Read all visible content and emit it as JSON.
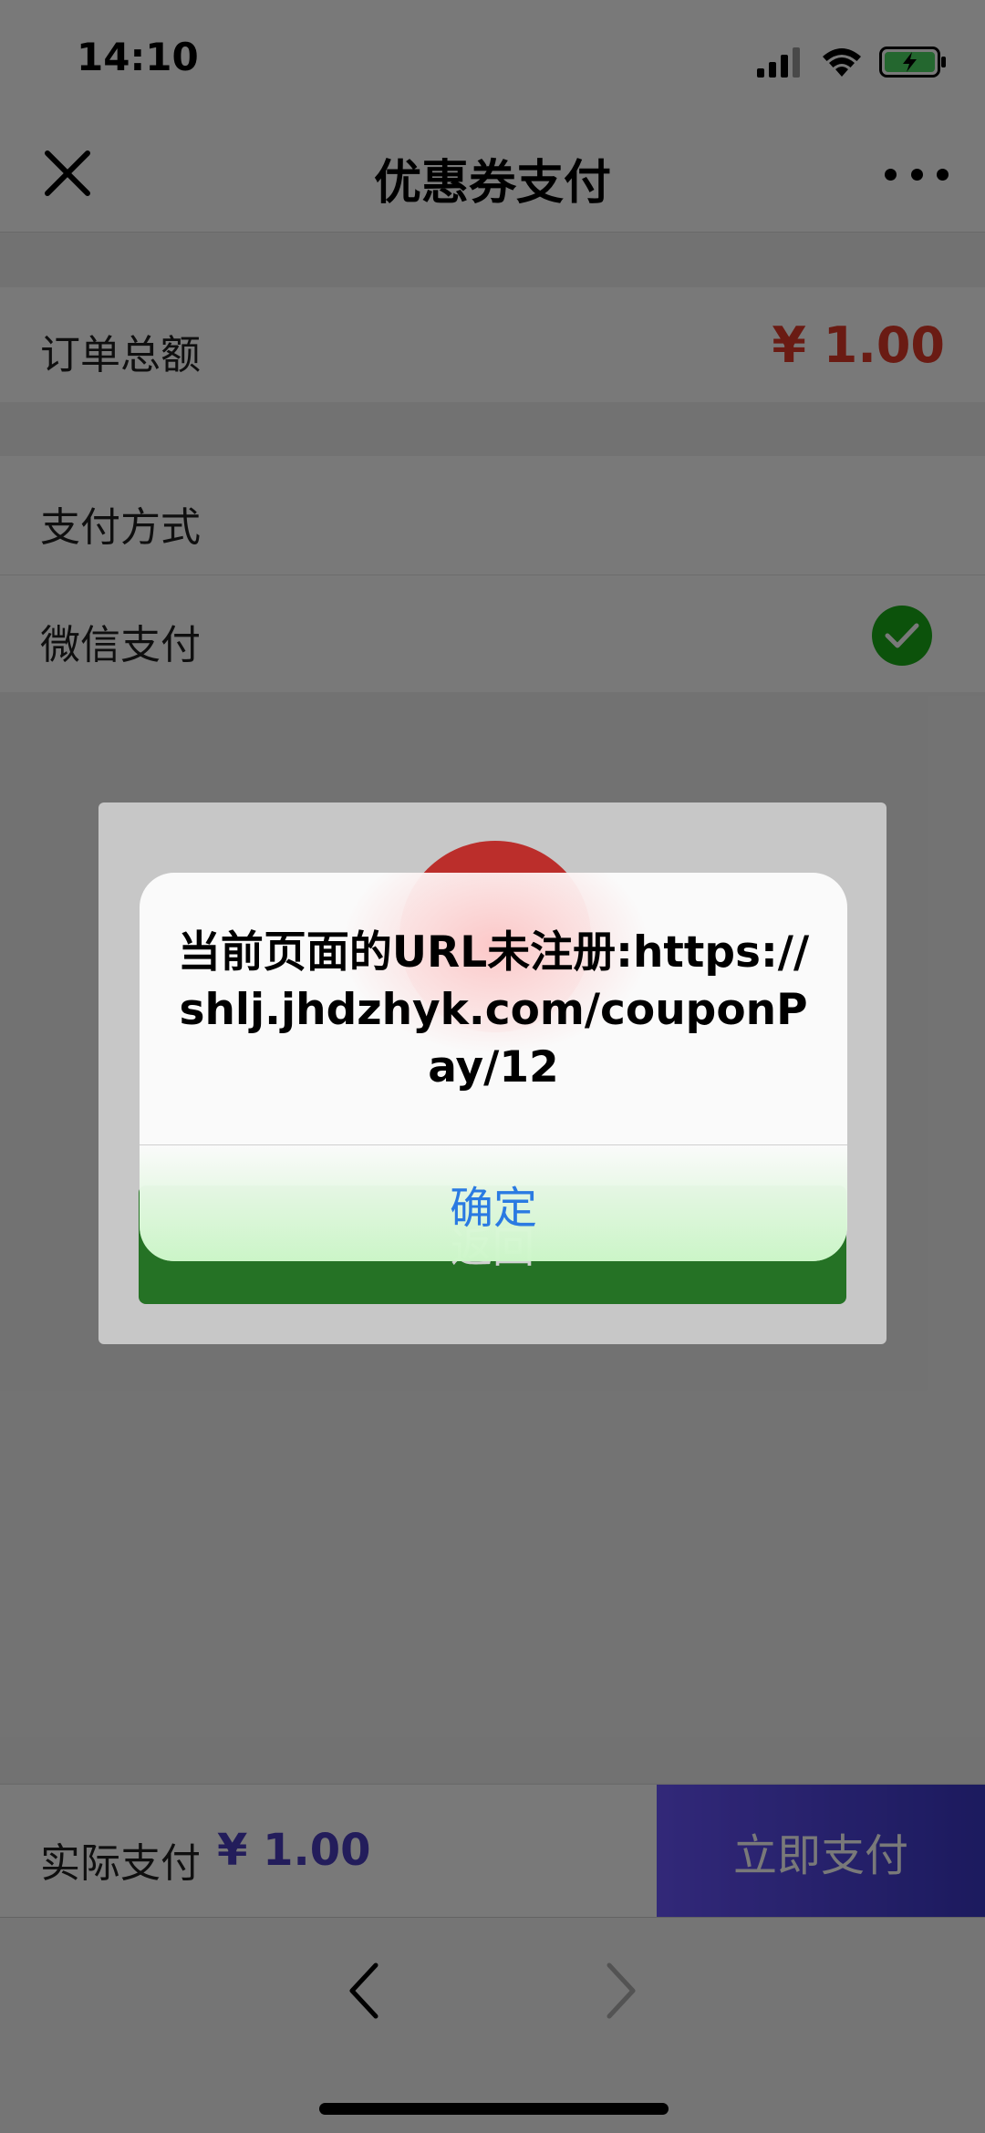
{
  "status_bar": {
    "time": "14:10"
  },
  "nav": {
    "title": "优惠券支付"
  },
  "order": {
    "label": "订单总额",
    "amount": "¥ 1.00"
  },
  "payment": {
    "header": "支付方式",
    "method": "微信支付"
  },
  "bottom": {
    "actual_label": "实际支付",
    "actual_amount": "¥ 1.00",
    "pay_button": "立即支付"
  },
  "page_modal": {
    "button_label": "返回"
  },
  "alert": {
    "message": "当前页面的URL未注册:https://shlj.jhdzhyk.com/couponPay/12",
    "ok_label": "确定"
  },
  "colors": {
    "price_red": "#e03c2a",
    "pay_button_start": "#6a56ff",
    "pay_button_end": "#3c39c7",
    "wechat_green": "#1aad19",
    "link_blue": "#2a7ae2"
  }
}
